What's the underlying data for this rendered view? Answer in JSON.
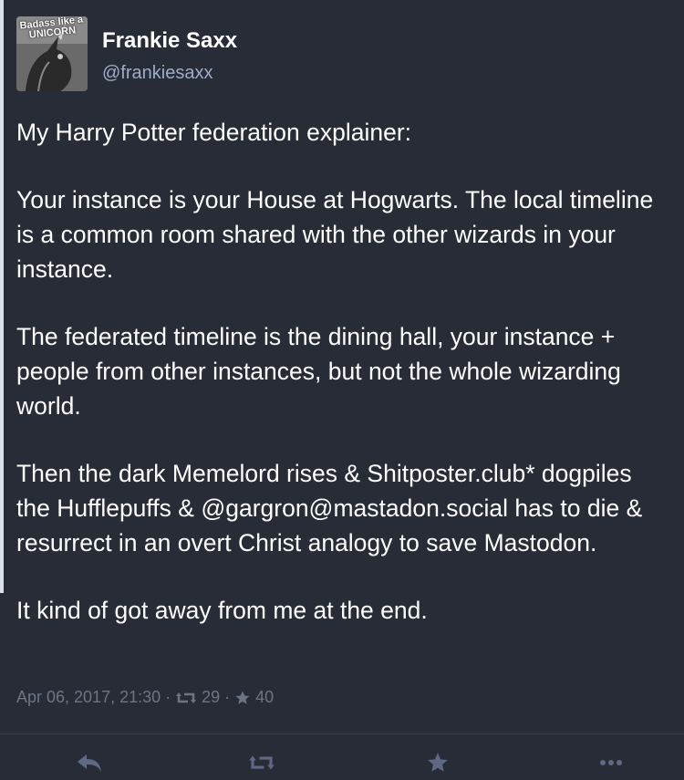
{
  "author": {
    "display_name": "Frankie Saxx",
    "handle": "@frankiesaxx",
    "avatar_caption_line1": "Badass like a",
    "avatar_caption_line2": "UNICORN"
  },
  "post": {
    "paragraphs": [
      "My Harry Potter federation explainer:",
      "Your instance is your House at Hogwarts. The local timeline is a common room shared with the other wizards in your instance.",
      "The federated timeline is the dining hall, your instance + people from other instances, but not the whole wizarding world.",
      "Then the dark Memelord rises & Shitposter.club* dogpiles the Hufflepuffs & @gargron@mastadon.social has to die & resurrect in an overt Christ analogy to save Mastodon.",
      "It kind of got away from me at the end."
    ]
  },
  "meta": {
    "timestamp": "Apr 06, 2017, 21:30",
    "separator": "·",
    "boost_count": "29",
    "favourite_count": "40"
  },
  "actions": {
    "reply_icon": "reply-icon",
    "boost_icon": "boost-icon",
    "favourite_icon": "star-icon",
    "more_icon": "more-icon"
  },
  "colors": {
    "background": "#282c37",
    "text": "#ffffff",
    "muted": "#6b7584",
    "handle": "#9baec8"
  }
}
